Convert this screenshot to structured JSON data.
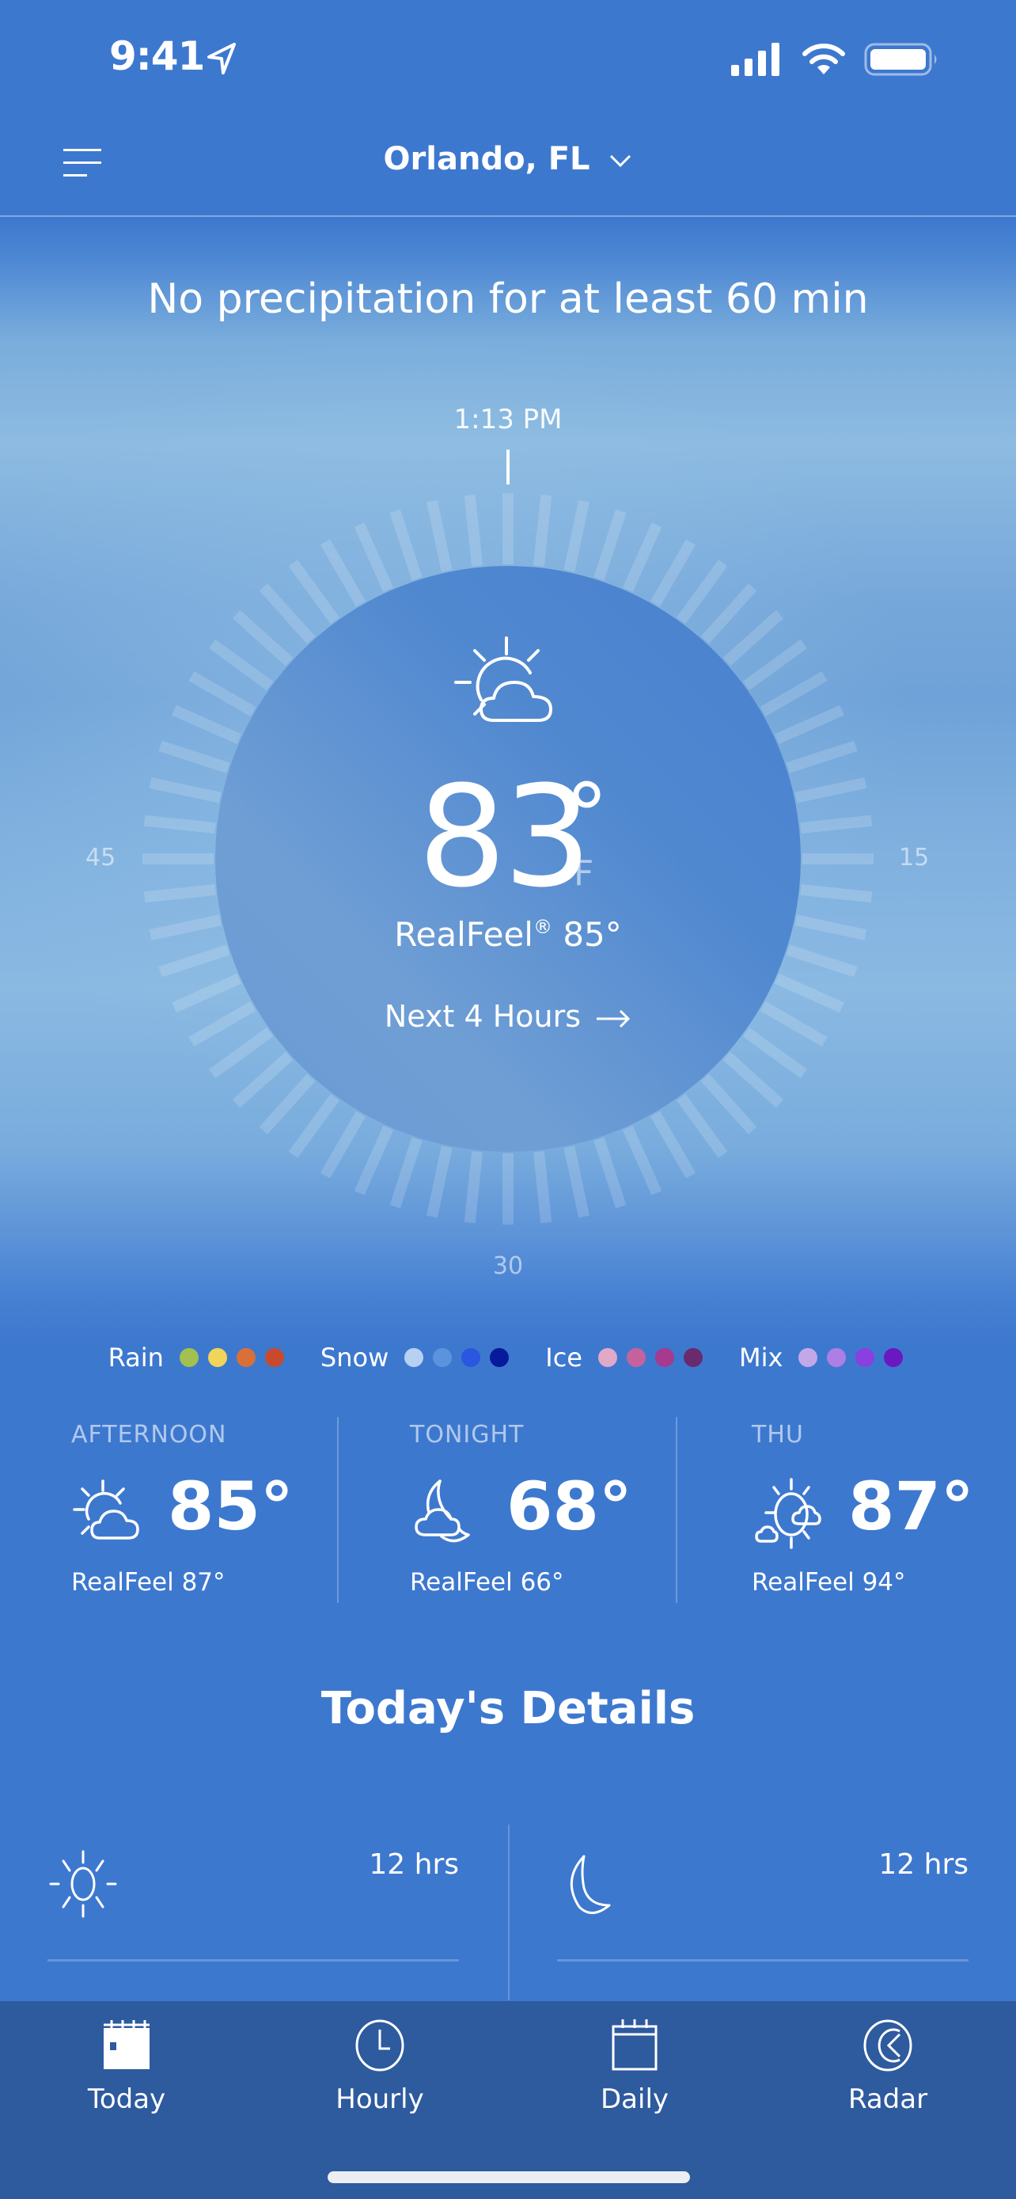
{
  "status_bar": {
    "time": "9:41",
    "icons": [
      "location-arrow-icon",
      "signal-icon",
      "wifi-icon",
      "battery-icon"
    ]
  },
  "header": {
    "menu_icon": "hamburger-menu-icon",
    "location": "Orlando, FL",
    "location_icon": "chevron-down-icon"
  },
  "minutecast": {
    "message": "No precipitation for at least 60 min",
    "current_time": "1:13 PM",
    "dial_labels": {
      "left": "45",
      "right": "15",
      "bottom": "30"
    },
    "dial_tick_count": 60
  },
  "current": {
    "icon": "partly-sunny-icon",
    "temperature": "83",
    "degree_symbol": "°",
    "unit": "F",
    "realfeel_label": "RealFeel",
    "realfeel_mark": "®",
    "realfeel_value": "85°",
    "next_hours_label": "Next 4 Hours",
    "next_hours_icon": "arrow-right-icon"
  },
  "legend": [
    {
      "label": "Rain",
      "colors": [
        "#a3c14f",
        "#f1d45a",
        "#d9703a",
        "#c84a2e"
      ]
    },
    {
      "label": "Snow",
      "colors": [
        "#b8d0f2",
        "#5b93de",
        "#2a56e0",
        "#071a9c"
      ]
    },
    {
      "label": "Ice",
      "colors": [
        "#e0a9c8",
        "#c5629e",
        "#a53a8e",
        "#6a2a6e"
      ]
    },
    {
      "label": "Mix",
      "colors": [
        "#c3a8e8",
        "#ad7ee6",
        "#8a3fe0",
        "#6a18c2"
      ]
    }
  ],
  "forecast": [
    {
      "label": "AFTERNOON",
      "icon": "partly-sunny-icon",
      "temp": "85°",
      "realfeel": "RealFeel 87°"
    },
    {
      "label": "TONIGHT",
      "icon": "partly-cloudy-night-icon",
      "temp": "68°",
      "realfeel": "RealFeel 66°"
    },
    {
      "label": "THU",
      "icon": "mostly-sunny-icon",
      "temp": "87°",
      "realfeel": "RealFeel 94°"
    }
  ],
  "details": {
    "title": "Today's Details",
    "items": [
      {
        "icon": "sun-icon",
        "value": "12 hrs"
      },
      {
        "icon": "moon-icon",
        "value": "12 hrs"
      }
    ]
  },
  "tabbar": {
    "tabs": [
      {
        "label": "Today",
        "icon": "calendar-today-icon",
        "active": true
      },
      {
        "label": "Hourly",
        "icon": "clock-icon",
        "active": false
      },
      {
        "label": "Daily",
        "icon": "calendar-icon",
        "active": false
      },
      {
        "label": "Radar",
        "icon": "radar-icon",
        "active": false
      }
    ]
  },
  "colors": {
    "background": "#3d78cf",
    "tabbar": "#2e5a9e",
    "dial_disk": "#5a8fd4"
  }
}
